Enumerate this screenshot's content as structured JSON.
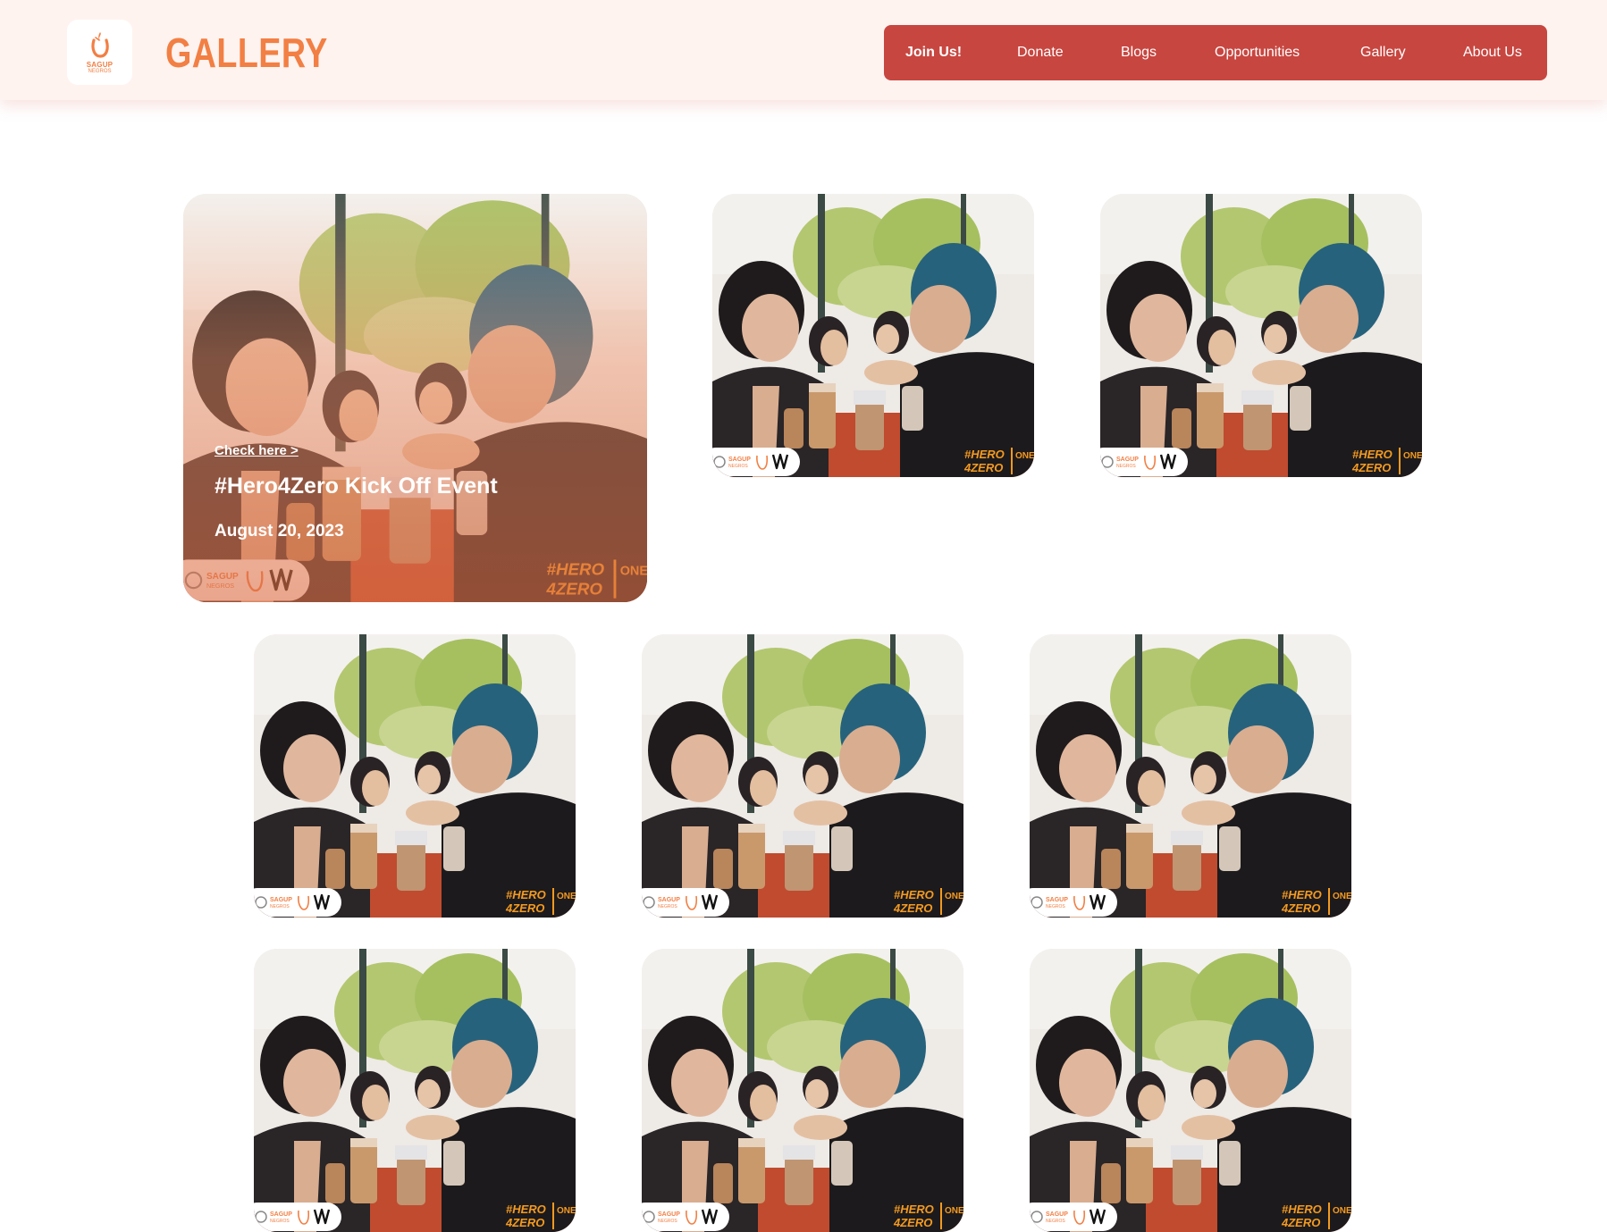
{
  "header": {
    "logo_text": "SAGUP",
    "logo_subtext": "NEGROS",
    "title": "GALLERY"
  },
  "nav": {
    "items": [
      {
        "label": "Join Us!"
      },
      {
        "label": "Donate"
      },
      {
        "label": "Blogs"
      },
      {
        "label": "Opportunities"
      },
      {
        "label": "Gallery"
      },
      {
        "label": "About Us"
      }
    ]
  },
  "featured": {
    "link": "Check here >",
    "title": "#Hero4Zero Kick Off Event",
    "date": "August 20, 2023"
  },
  "photo_overlay": {
    "brand": "SAGUP",
    "brand_sub": "NEGROS",
    "hashtag_line1": "#HERO",
    "hashtag_line2": "4ZERO",
    "side_text": "ONE SE"
  },
  "colors": {
    "accent": "#f27f43",
    "nav_bg": "#c84640",
    "header_bg": "#fff3f0"
  }
}
